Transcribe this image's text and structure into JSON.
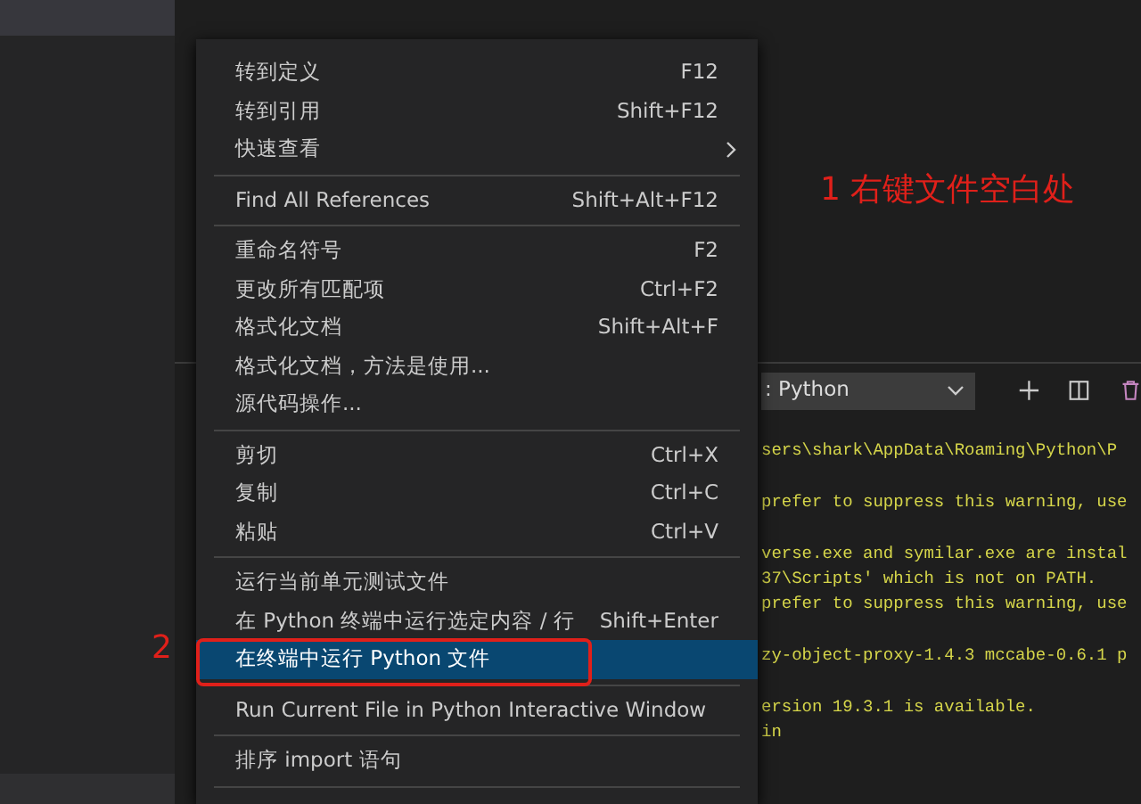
{
  "context_menu": {
    "items": [
      {
        "kind": "item",
        "label": "转到定义",
        "shortcut": "F12",
        "submenu": false,
        "selected": false
      },
      {
        "kind": "item",
        "label": "转到引用",
        "shortcut": "Shift+F12",
        "submenu": false,
        "selected": false
      },
      {
        "kind": "item",
        "label": "快速查看",
        "submenu": true,
        "selected": false
      },
      {
        "kind": "separator"
      },
      {
        "kind": "item",
        "label": "Find All References",
        "shortcut": "Shift+Alt+F12",
        "submenu": false,
        "selected": false
      },
      {
        "kind": "separator"
      },
      {
        "kind": "item",
        "label": "重命名符号",
        "shortcut": "F2",
        "submenu": false,
        "selected": false
      },
      {
        "kind": "item",
        "label": "更改所有匹配项",
        "shortcut": "Ctrl+F2",
        "submenu": false,
        "selected": false
      },
      {
        "kind": "item",
        "label": "格式化文档",
        "shortcut": "Shift+Alt+F",
        "submenu": false,
        "selected": false
      },
      {
        "kind": "item",
        "label": "格式化文档，方法是使用...",
        "submenu": false,
        "selected": false
      },
      {
        "kind": "item",
        "label": "源代码操作...",
        "submenu": false,
        "selected": false
      },
      {
        "kind": "separator"
      },
      {
        "kind": "item",
        "label": "剪切",
        "shortcut": "Ctrl+X",
        "submenu": false,
        "selected": false
      },
      {
        "kind": "item",
        "label": "复制",
        "shortcut": "Ctrl+C",
        "submenu": false,
        "selected": false
      },
      {
        "kind": "item",
        "label": "粘贴",
        "shortcut": "Ctrl+V",
        "submenu": false,
        "selected": false
      },
      {
        "kind": "separator"
      },
      {
        "kind": "item",
        "label": "运行当前单元测试文件",
        "submenu": false,
        "selected": false
      },
      {
        "kind": "item",
        "label": "在 Python 终端中运行选定内容 / 行",
        "shortcut": "Shift+Enter",
        "submenu": false,
        "selected": false
      },
      {
        "kind": "item",
        "label": "在终端中运行 Python 文件",
        "submenu": false,
        "selected": true
      },
      {
        "kind": "separator"
      },
      {
        "kind": "item",
        "label": "Run Current File in Python Interactive Window",
        "submenu": false,
        "selected": false
      },
      {
        "kind": "separator"
      },
      {
        "kind": "item",
        "label": "排序 import 语句",
        "submenu": false,
        "selected": false
      },
      {
        "kind": "separator"
      }
    ]
  },
  "annotations": [
    {
      "kind": "text",
      "text": "1 右键文件空白处"
    },
    {
      "kind": "step",
      "text": "2"
    }
  ],
  "terminal": {
    "shell_dropdown": ": Python",
    "paragraphs": [
      [
        "sers\\shark\\AppData\\Roaming\\Python\\P"
      ],
      [
        "prefer to suppress this warning, use"
      ],
      [
        "verse.exe and symilar.exe are instal",
        "37\\Scripts' which is not on PATH.",
        "prefer to suppress this warning, use"
      ],
      [
        "zy-object-proxy-1.4.3 mccabe-0.6.1 p"
      ],
      [
        "ersion 19.3.1 is available.",
        "in"
      ]
    ]
  }
}
